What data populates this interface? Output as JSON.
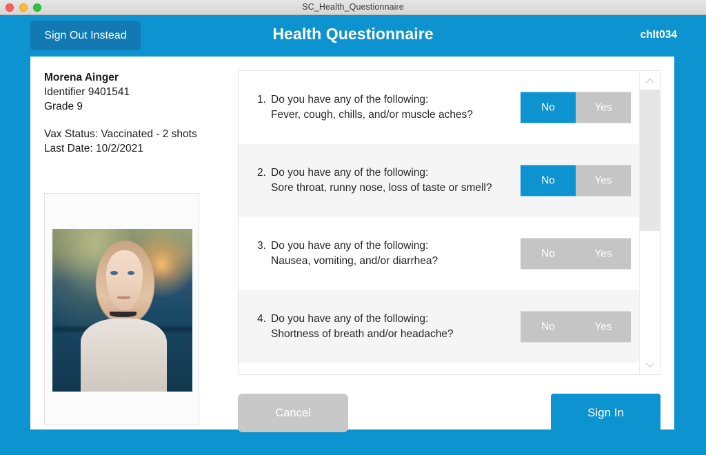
{
  "titlebar": {
    "title": "SC_Health_Questionnaire",
    "buttons": [
      "close-button",
      "minimize-button",
      "maximize-button"
    ]
  },
  "header": {
    "sign_out_label": "Sign Out Instead",
    "title": "Health Questionnaire",
    "user": "chlt034",
    "accent_color": "#0d93cf",
    "button_color": "#1279b3"
  },
  "student": {
    "name": "Morena Ainger",
    "identifier": "Identifier 9401541",
    "grade": "Grade 9",
    "vax_status": "Vax Status: Vaccinated - 2 shots",
    "last_date": "Last Date: 10/2/2021",
    "photo_alt": "student-portrait"
  },
  "questionnaire": {
    "scroll": {
      "up_icon": "chevron-up-icon",
      "down_icon": "chevron-down-icon",
      "thumb_position_percent": 6
    },
    "questions": [
      {
        "number": "1.",
        "prompt": "Do you have any of the following:",
        "detail": "Fever, cough, chills, and/or muscle aches?",
        "options": [
          "No",
          "Yes"
        ],
        "selected": "No"
      },
      {
        "number": "2.",
        "prompt": "Do you have any of the following:",
        "detail": "Sore throat, runny nose, loss of taste or smell?",
        "options": [
          "No",
          "Yes"
        ],
        "selected": "No"
      },
      {
        "number": "3.",
        "prompt": "Do you have any of the following:",
        "detail": "Nausea, vomiting, and/or diarrhea?",
        "options": [
          "No",
          "Yes"
        ],
        "selected": null
      },
      {
        "number": "4.",
        "prompt": "Do you have any of the following:",
        "detail": "Shortness of breath and/or headache?",
        "options": [
          "No",
          "Yes"
        ],
        "selected": null
      }
    ]
  },
  "footer": {
    "cancel_label": "Cancel",
    "signin_label": "Sign In",
    "cancel_color": "#c8c8c8",
    "signin_color": "#0d93cf"
  }
}
